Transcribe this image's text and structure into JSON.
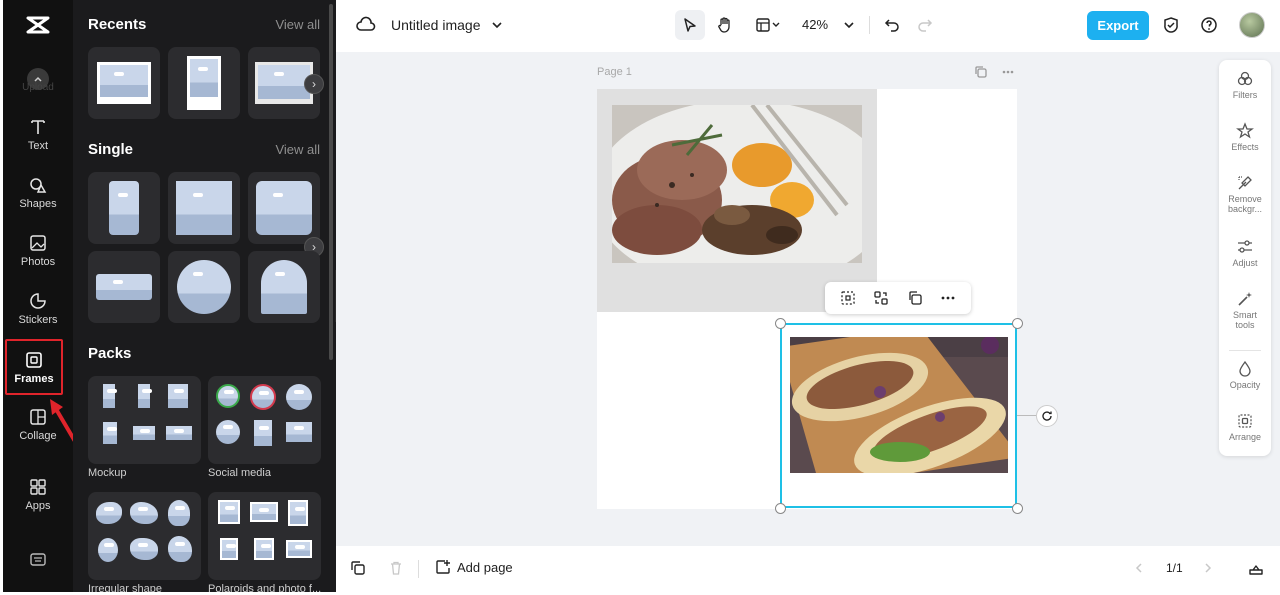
{
  "rail": {
    "up_label": "Upload",
    "items": [
      {
        "label": "Text",
        "icon": "text-icon"
      },
      {
        "label": "Shapes",
        "icon": "shapes-icon"
      },
      {
        "label": "Photos",
        "icon": "photos-icon"
      },
      {
        "label": "Stickers",
        "icon": "stickers-icon"
      },
      {
        "label": "Frames",
        "icon": "frames-icon",
        "active": true
      },
      {
        "label": "Collage",
        "icon": "collage-icon"
      },
      {
        "label": "Apps",
        "icon": "apps-icon"
      }
    ],
    "highlight_color": "#e0242b"
  },
  "panel": {
    "recents_title": "Recents",
    "single_title": "Single",
    "packs_title": "Packs",
    "view_all": "View all",
    "packs": [
      {
        "label": "Mockup"
      },
      {
        "label": "Social media"
      },
      {
        "label": "Irregular shape"
      },
      {
        "label": "Polaroids and photo f..."
      }
    ]
  },
  "topbar": {
    "doc_title": "Untitled image",
    "zoom": "42%",
    "export_label": "Export",
    "accent": "#1db0f0"
  },
  "canvas": {
    "page_label": "Page 1"
  },
  "right_tools": [
    {
      "label": "Filters",
      "icon": "filters-icon"
    },
    {
      "label": "Effects",
      "icon": "effects-icon"
    },
    {
      "label": "Remove backgr...",
      "icon": "remove-background-icon"
    },
    {
      "label": "Adjust",
      "icon": "adjust-icon"
    },
    {
      "label": "Smart tools",
      "icon": "smart-tools-icon"
    },
    {
      "label": "Opacity",
      "icon": "opacity-icon"
    },
    {
      "label": "Arrange",
      "icon": "arrange-icon"
    }
  ],
  "bottombar": {
    "add_page": "Add page",
    "page_count": "1/1"
  }
}
